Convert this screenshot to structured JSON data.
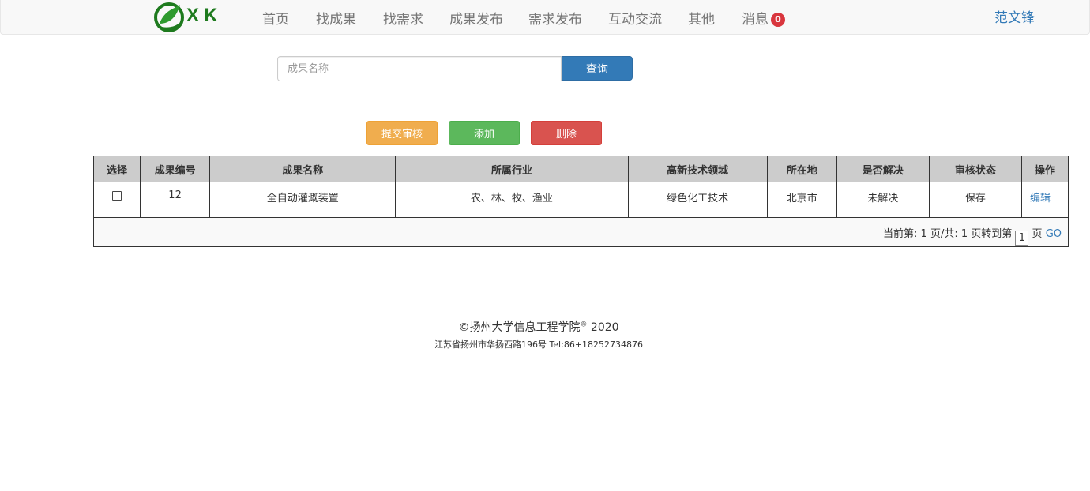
{
  "nav": {
    "logo_text": "XK",
    "items": [
      "首页",
      "找成果",
      "找需求",
      "成果发布",
      "需求发布",
      "互动交流",
      "其他",
      "消息"
    ],
    "message_count": "0",
    "user": "范文锋"
  },
  "search": {
    "placeholder": "成果名称",
    "button": "查询"
  },
  "actions": {
    "submit": "提交审核",
    "add": "添加",
    "delete": "删除"
  },
  "table": {
    "headers": [
      "选择",
      "成果编号",
      "成果名称",
      "所属行业",
      "高新技术领域",
      "所在地",
      "是否解决",
      "审核状态",
      "操作"
    ],
    "rows": [
      {
        "id": "12",
        "name": "全自动灌溉装置",
        "industry": "农、林、牧、渔业",
        "tech_field": "绿色化工技术",
        "location": "北京市",
        "solved": "未解决",
        "status": "保存",
        "action": "编辑"
      }
    ]
  },
  "pager": {
    "text": "当前第: 1 页/共: 1 页转到第",
    "page_value": "1",
    "suffix": "页",
    "go": "GO"
  },
  "footer": {
    "line1": "©扬州大学信息工程学院",
    "line1_mark": "®",
    "line1_year": "2020",
    "line2": "江苏省扬州市华扬西路196号 Tel:86+18252734876"
  },
  "colors": {
    "primary": "#337ab7",
    "warning": "#f0ad4e",
    "success": "#5cb85c",
    "danger": "#d9534f",
    "badge": "#d9363e",
    "logo_green": "#1e7a1e"
  }
}
